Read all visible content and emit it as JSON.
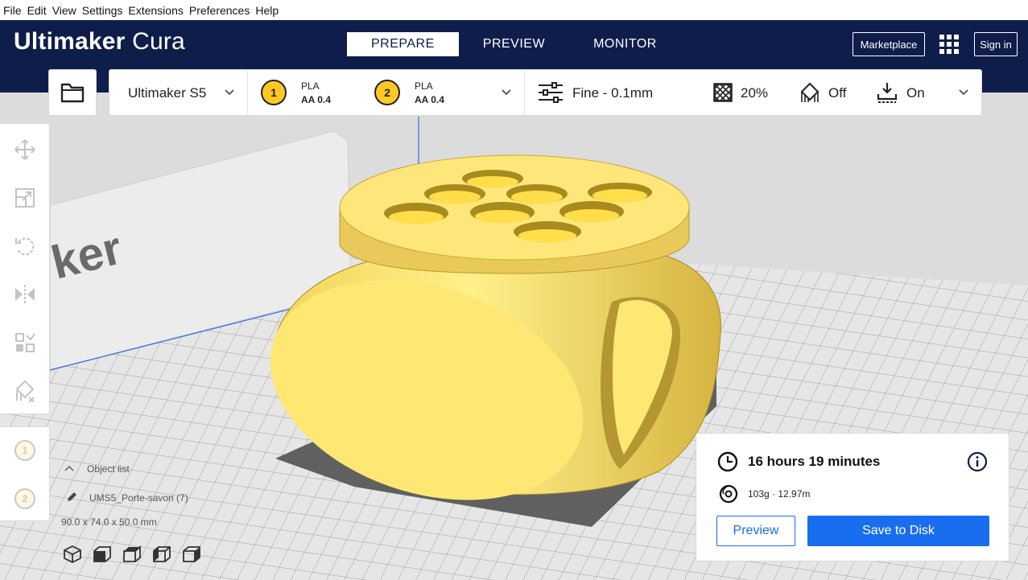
{
  "menu": [
    "File",
    "Edit",
    "View",
    "Settings",
    "Extensions",
    "Preferences",
    "Help"
  ],
  "header": {
    "logo_bold": "Ultimaker",
    "logo_light": "Cura",
    "tabs": [
      "PREPARE",
      "PREVIEW",
      "MONITOR"
    ],
    "active_tab": "PREPARE",
    "marketplace": "Marketplace",
    "sign_in": "Sign in"
  },
  "printer": {
    "name": "Ultimaker S5",
    "extruder1": {
      "number": "1",
      "material": "PLA",
      "nozzle": "AA 0.4"
    },
    "extruder2": {
      "number": "2",
      "material": "PLA",
      "nozzle": "AA 0.4"
    }
  },
  "print_settings": {
    "profile": "Fine - 0.1mm",
    "infill": "20%",
    "support": "Off",
    "adhesion": "On"
  },
  "viewport": {
    "plate_text": "ker"
  },
  "object_list": {
    "header": "Object list",
    "object_name": "UMS5_Porte-savon (7)",
    "dimensions": "90.0 x 74.0 x 50.0 mm"
  },
  "print_info": {
    "time": "16 hours 19 minutes",
    "material": "103g · 12.97m",
    "preview_button": "Preview",
    "save_button": "Save to Disk"
  },
  "colors": {
    "header_bg": "#0f1d4a",
    "accent_blue": "#196ef0",
    "model_yellow": "#ffe066",
    "extruder_yellow": "#ffc924"
  },
  "icons": {
    "open": "folder-icon",
    "profile": "sliders-icon",
    "infill": "infill-icon",
    "support": "support-icon",
    "adhesion": "adhesion-icon",
    "time": "clock-icon",
    "material": "spool-icon",
    "info": "info-icon"
  }
}
